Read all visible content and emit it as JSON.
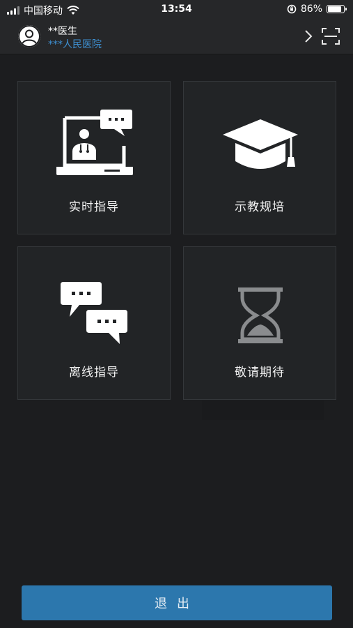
{
  "status_bar": {
    "carrier": "中国移动",
    "time": "13:54",
    "battery_percent": "86%",
    "battery_level": 0.86
  },
  "header": {
    "doctor_name": "**医生",
    "hospital_name": "***人民医院"
  },
  "tiles": [
    {
      "label": "实时指导",
      "icon": "video-consult-icon"
    },
    {
      "label": "示教规培",
      "icon": "graduation-cap-icon"
    },
    {
      "label": "离线指导",
      "icon": "chat-bubbles-icon"
    },
    {
      "label": "敬请期待",
      "icon": "hourglass-icon"
    }
  ],
  "logout_label": "退出",
  "colors": {
    "background": "#1c1d1f",
    "tile_background": "#222426",
    "accent_blue": "#2c77ad",
    "hospital_text": "#3e8fd0"
  }
}
